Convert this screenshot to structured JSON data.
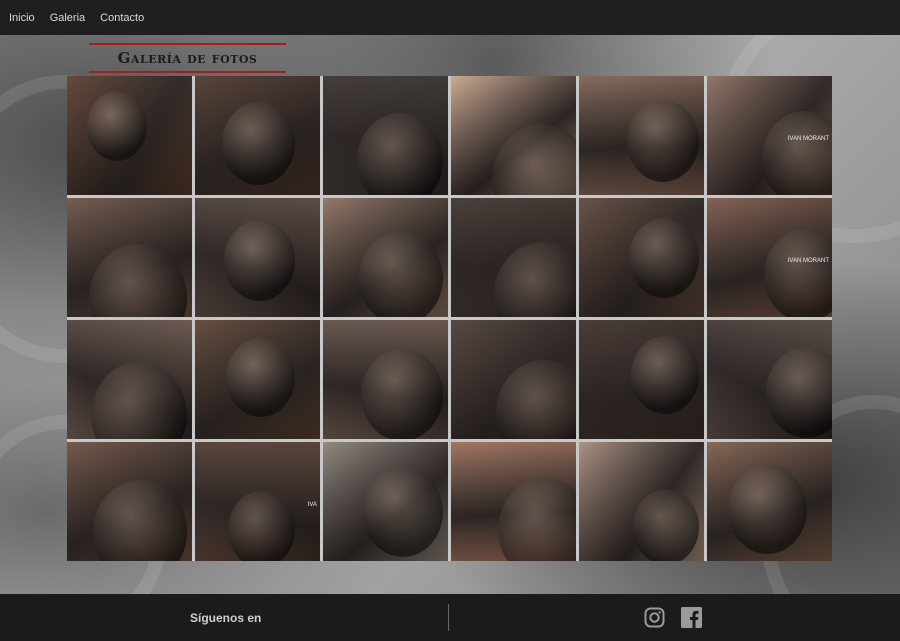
{
  "nav": {
    "items": [
      {
        "label": "Inicio"
      },
      {
        "label": "Galeria"
      },
      {
        "label": "Contacto"
      }
    ]
  },
  "gallery": {
    "title": "Galería de fotos",
    "thumbnails": [
      {
        "color": "#5a3a2c",
        "caption": ""
      },
      {
        "color": "#4c342a",
        "caption": ""
      },
      {
        "color": "#3a3330",
        "caption": ""
      },
      {
        "color": "#c9a48c",
        "caption": ""
      },
      {
        "color": "#7d5f50",
        "caption": ""
      },
      {
        "color": "#8a6b5e",
        "caption": "IVAN MORANT"
      },
      {
        "color": "#6a5044",
        "caption": ""
      },
      {
        "color": "#5a4840",
        "caption": ""
      },
      {
        "color": "#8b6e5e",
        "caption": ""
      },
      {
        "color": "#3d312c",
        "caption": ""
      },
      {
        "color": "#5c4438",
        "caption": ""
      },
      {
        "color": "#7a5646",
        "caption": "IVAN MORANT"
      },
      {
        "color": "#6f5a50",
        "caption": ""
      },
      {
        "color": "#59402f",
        "caption": ""
      },
      {
        "color": "#6b574d",
        "caption": ""
      },
      {
        "color": "#4a3a33",
        "caption": ""
      },
      {
        "color": "#3c2d28",
        "caption": ""
      },
      {
        "color": "#574a44",
        "caption": ""
      },
      {
        "color": "#6a4c3e",
        "caption": ""
      },
      {
        "color": "#5a4034",
        "caption": "IVA"
      },
      {
        "color": "#8a8078",
        "caption": ""
      },
      {
        "color": "#9a6c58",
        "caption": ""
      },
      {
        "color": "#a58a7a",
        "caption": ""
      },
      {
        "color": "#7c5c48",
        "caption": ""
      }
    ]
  },
  "footer": {
    "follow_label": "Síguenos en",
    "social": [
      {
        "icon": "instagram-icon"
      },
      {
        "icon": "facebook-icon"
      }
    ]
  },
  "colors": {
    "nav_bg": "#1f1f1f",
    "footer_bg": "#1b1b1b",
    "title_accent": "#a51d1d"
  }
}
